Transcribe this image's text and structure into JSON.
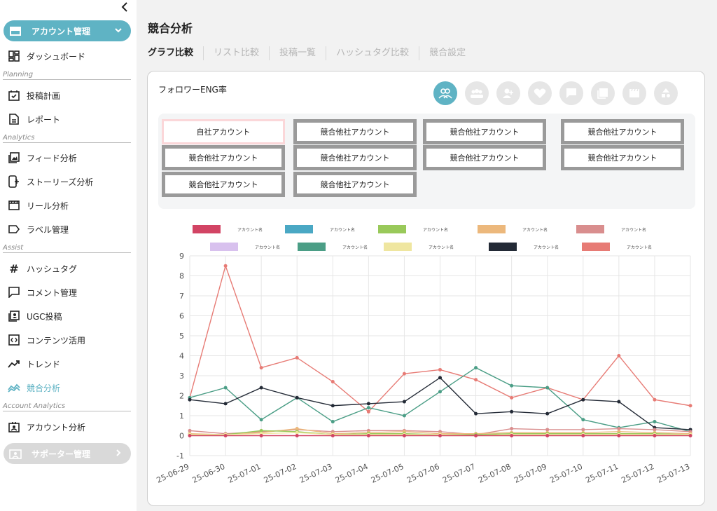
{
  "sidebar": {
    "account_pill": "アカウント管理",
    "supporter_pill": "サポーター管理",
    "items_top": [
      {
        "label": "ダッシュボード",
        "icon": "dashboard-icon"
      }
    ],
    "sections": {
      "planning": "Planning",
      "analytics": "Analytics",
      "assist": "Assist",
      "account_analytics": "Account Analytics"
    },
    "planning_items": [
      {
        "label": "投稿計画",
        "icon": "calendar-check-icon"
      },
      {
        "label": "レポート",
        "icon": "document-icon"
      }
    ],
    "analytics_items": [
      {
        "label": "フィード分析",
        "icon": "image-frame-icon"
      },
      {
        "label": "ストーリーズ分析",
        "icon": "phone-story-icon"
      },
      {
        "label": "リール分析",
        "icon": "clapper-icon"
      },
      {
        "label": "ラベル管理",
        "icon": "label-tag-icon"
      }
    ],
    "assist_items": [
      {
        "label": "ハッシュタグ",
        "icon": "hashtag-icon"
      },
      {
        "label": "コメント管理",
        "icon": "comment-icon"
      },
      {
        "label": "UGC投稿",
        "icon": "ugc-icon"
      },
      {
        "label": "コンテンツ活用",
        "icon": "content-icon"
      },
      {
        "label": "トレンド",
        "icon": "trend-icon"
      },
      {
        "label": "競合分析",
        "icon": "competitor-icon"
      }
    ],
    "account_analytics_items": [
      {
        "label": "アカウント分析",
        "icon": "account-analysis-icon"
      }
    ]
  },
  "main": {
    "title": "競合分析",
    "tabs": [
      "グラフ比較",
      "リスト比較",
      "投稿一覧",
      "ハッシュタグ比較",
      "競合設定"
    ],
    "card_title": "フォロワーENG率",
    "metric_icons": [
      "followers-icon",
      "group-icon",
      "user-icon",
      "heart-icon",
      "comment-icon",
      "image-icon",
      "reel-icon",
      "shape-icon"
    ],
    "accounts": {
      "self": "自社アカウント",
      "competitor": "競合他社アカウント"
    }
  },
  "colors": {
    "accent": "#5fb3c4",
    "series": [
      "#d24464",
      "#4aa8c4",
      "#99c95a",
      "#ecb87c",
      "#d98e8e",
      "#d8c1ee",
      "#4b9e86",
      "#efe6a0",
      "#232a36",
      "#e77b75"
    ]
  },
  "chart_data": {
    "type": "line",
    "legend": [
      {
        "label": "アカウント名",
        "color": "#d24464"
      },
      {
        "label": "アカウント名",
        "color": "#4aa8c4"
      },
      {
        "label": "アカウント名",
        "color": "#99c95a"
      },
      {
        "label": "アカウント名",
        "color": "#ecb87c"
      },
      {
        "label": "アカウント名",
        "color": "#d98e8e"
      },
      {
        "label": "アカウント名",
        "color": "#d8c1ee"
      },
      {
        "label": "アカウント名",
        "color": "#4b9e86"
      },
      {
        "label": "アカウント名",
        "color": "#efe6a0"
      },
      {
        "label": "アカウント名",
        "color": "#232a36"
      },
      {
        "label": "アカウント名",
        "color": "#e77b75"
      }
    ],
    "x": [
      "25-06-29",
      "25-06-30",
      "25-07-01",
      "25-07-02",
      "25-07-03",
      "25-07-04",
      "25-07-05",
      "25-07-06",
      "25-07-07",
      "25-07-08",
      "25-07-09",
      "25-07-10",
      "25-07-11",
      "25-07-12",
      "25-07-13"
    ],
    "ylim": [
      -1,
      9
    ],
    "yticks": [
      "9",
      "8",
      "7",
      "6",
      "5",
      "4",
      "3",
      "2",
      "1",
      "0",
      "-1"
    ],
    "grid": true,
    "series": [
      {
        "color": "#e77b75",
        "values": [
          1.9,
          8.5,
          3.4,
          3.9,
          2.7,
          1.2,
          3.1,
          3.3,
          2.8,
          1.9,
          2.4,
          1.8,
          4.0,
          1.8,
          1.5
        ]
      },
      {
        "color": "#4b9e86",
        "values": [
          1.9,
          2.4,
          0.8,
          1.9,
          0.7,
          1.4,
          1.0,
          2.2,
          3.4,
          2.5,
          2.4,
          0.8,
          0.4,
          0.7,
          0.2
        ]
      },
      {
        "color": "#232a36",
        "values": [
          1.8,
          1.6,
          2.4,
          1.9,
          1.5,
          1.6,
          1.7,
          2.9,
          1.1,
          1.2,
          1.1,
          1.8,
          1.7,
          0.4,
          0.3
        ]
      },
      {
        "color": "#d98e8e",
        "values": [
          0.25,
          0.1,
          0.2,
          0.3,
          0.2,
          0.25,
          0.25,
          0.2,
          0.05,
          0.35,
          0.3,
          0.3,
          0.35,
          0.3,
          0.2
        ]
      },
      {
        "color": "#ecb87c",
        "values": [
          0.1,
          0.05,
          0.15,
          0.35,
          0.1,
          0.15,
          0.2,
          0.1,
          0.1,
          0.15,
          0.15,
          0.15,
          0.2,
          0.15,
          0.1
        ]
      },
      {
        "color": "#99c95a",
        "values": [
          0.05,
          0.05,
          0.25,
          0.2,
          0.05,
          0.1,
          0.1,
          0.05,
          0.05,
          0.1,
          0.1,
          0.1,
          0.1,
          0.1,
          0.05
        ]
      },
      {
        "color": "#efe6a0",
        "values": [
          0.05,
          0.05,
          0.1,
          0.15,
          0.05,
          0.05,
          0.05,
          0.05,
          0.0,
          0.05,
          0.05,
          0.05,
          0.05,
          0.05,
          0.05
        ]
      },
      {
        "color": "#d24464",
        "values": [
          0,
          0,
          0,
          0,
          0,
          0,
          0,
          0,
          0,
          0,
          0,
          0,
          0,
          0,
          0
        ]
      }
    ]
  }
}
